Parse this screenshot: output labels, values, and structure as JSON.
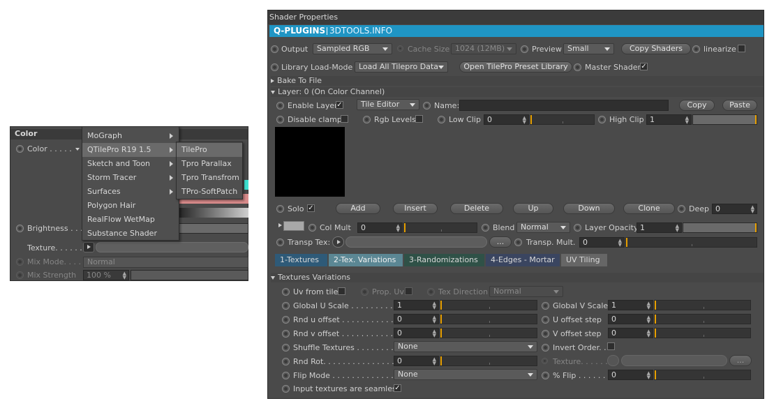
{
  "color_panel": {
    "header": "Color",
    "color_label": "Color . . . . .",
    "brightness_label": "Brightness . . .",
    "texture_label": "Texture. . . . . . . .",
    "mix_mode_label": "Mix Mode. . . . .",
    "mix_mode_value": "Normal",
    "mix_strength_label": "Mix Strength",
    "mix_strength_value": "100 %"
  },
  "context_menu": {
    "items": [
      "MoGraph",
      "QTilePro R19 1.5",
      "Sketch and Toon",
      "Storm Tracer",
      "Surfaces",
      "Polygon Hair",
      "RealFlow WetMap",
      "Substance Shader"
    ],
    "submenu": [
      "TilePro",
      "Tpro Parallax",
      "Tpro Transfrom",
      "TPro-SoftPatch"
    ]
  },
  "shader": {
    "window_title": "Shader Properties",
    "brand": "Q-PLUGINS",
    "brand_site": "3DTOOLS.INFO",
    "output_label": "Output",
    "output_value": "Sampled RGB",
    "cache_label": "Cache Size",
    "cache_value": "1024 (12MB)",
    "preview_label": "Preview",
    "preview_value": "Small",
    "copy_shaders": "Copy Shaders",
    "linearize": "linearize",
    "library_label": "Library Load-Mode",
    "library_value": "Load All Tilepro Data",
    "open_library": "Open TilePro Preset Library",
    "master_shader": "Master Shader",
    "bake": "Bake To File",
    "layer_header": "Layer: 0 (On Color Channel)",
    "enable_layer": "Enable Layer",
    "tile_editor": "Tile Editor",
    "name_label": "Name:",
    "copy": "Copy",
    "paste": "Paste",
    "disable_clamp": "Disable clamp",
    "rgb_levels": "Rgb Levels",
    "low_clip_label": "Low Clip",
    "low_clip_value": "0",
    "high_clip_label": "High Clip",
    "high_clip_value": "1",
    "solo": "Solo",
    "add": "Add",
    "insert": "Insert",
    "delete": "Delete",
    "up": "Up",
    "down": "Down",
    "clone": "Clone",
    "deep_label": "Deep",
    "deep_value": "0",
    "col_mult_label": "Col Mult",
    "col_mult_value": "0",
    "blend_label": "Blend",
    "blend_value": "Normal",
    "layer_opacity_label": "Layer Opacity",
    "layer_opacity_value": "1",
    "transp_tex": "Transp Tex:",
    "ellipsis": "...",
    "transp_mult_label": "Transp. Mult.",
    "transp_mult_value": "0"
  },
  "tabs": [
    "1-Textures",
    "2-Tex. Variations",
    "3-Randomizations",
    "4-Edges - Mortar",
    "UV Tiling"
  ],
  "variations": {
    "header": "Textures Variations",
    "uv_from_tile": "Uv from tile",
    "prop_uv": "Prop. Uv",
    "tex_direction": "Tex Direction",
    "tex_direction_value": "Normal",
    "global_u_label": "Global U Scale . . . . . . . . . . .",
    "global_u_value": "1",
    "global_v_label": "Global V Scale",
    "global_v_value": "1",
    "rnd_u_label": "Rnd u offset . . . . . . . . . . . .",
    "rnd_u_value": "0",
    "u_offset_label": "U offset step",
    "u_offset_value": "0",
    "rnd_v_label": "Rnd v offset . . . . . . . . . . . .",
    "rnd_v_value": "0",
    "v_offset_label": "V offset step",
    "v_offset_value": "0",
    "shuffle_label": "Shuffle Textures . . . . . . . . .",
    "shuffle_value": "None",
    "invert_order": "Invert Order. .",
    "rnd_rot_label": "Rnd Rot. . . . . . . . . . . . . . . .",
    "rnd_rot_value": "0",
    "texture_label": "Texture. . . . . .",
    "texture_btn": "...",
    "flip_mode_label": "Flip Mode . . . . . . . . . . . . . .",
    "flip_mode_value": "None",
    "pct_flip_label": "% Flip . . . . . .",
    "pct_flip_value": "0",
    "seamless": "Input textures are seamless"
  },
  "colors": {
    "panel": "#4a4a4a",
    "brand_bar": "#1f95c4",
    "accent_marker": "#e8a000",
    "active_tab": "#5b8794"
  }
}
